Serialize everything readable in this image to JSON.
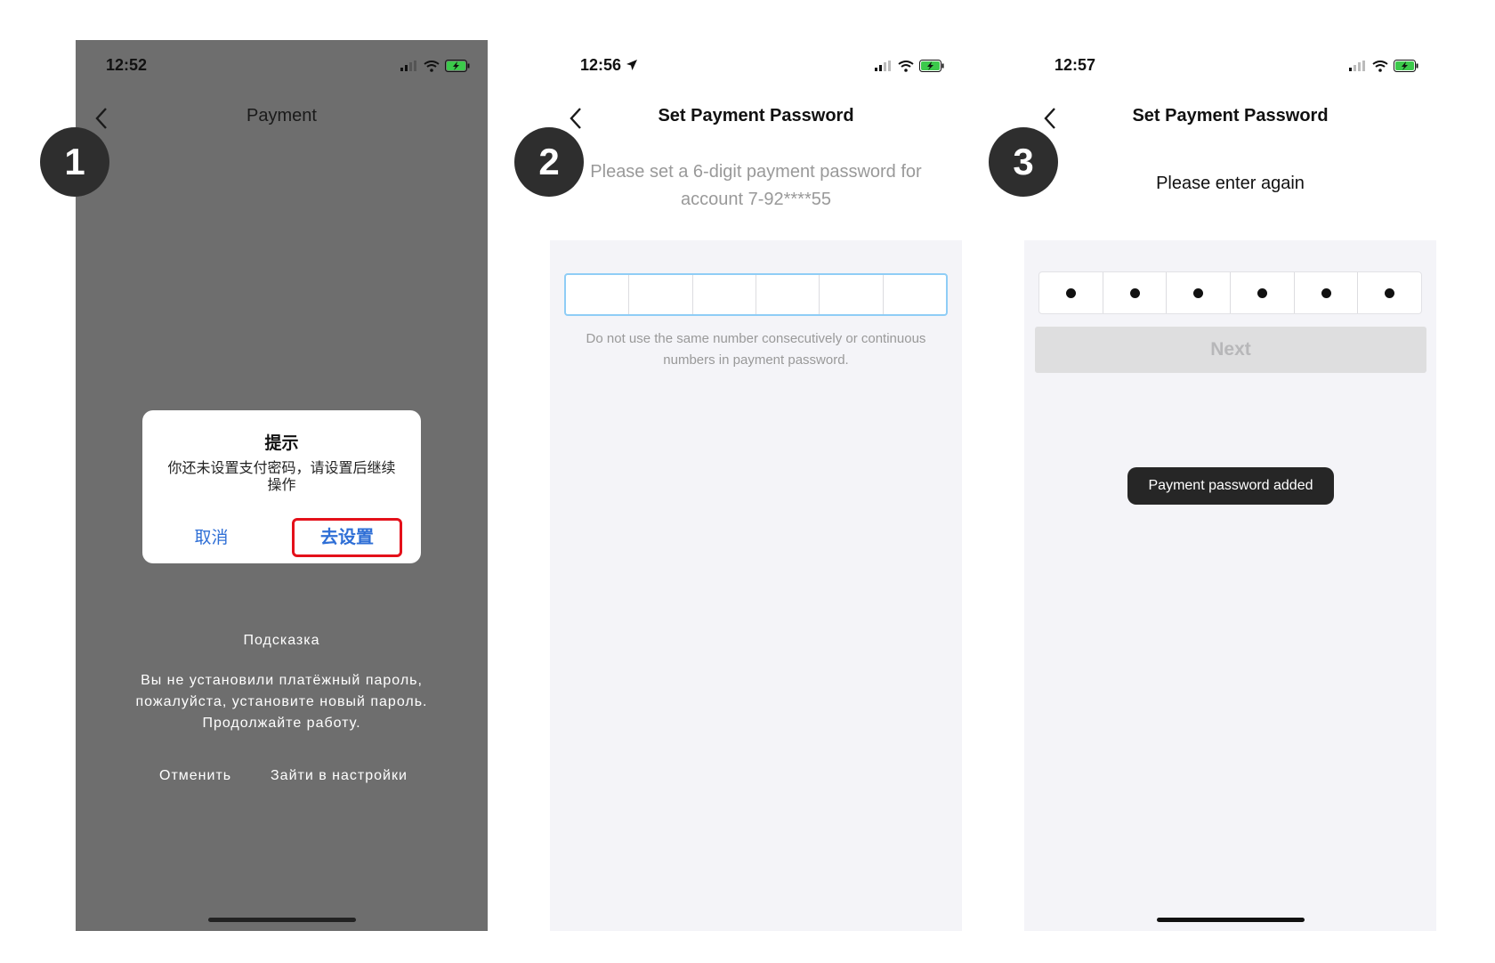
{
  "screens": [
    {
      "step": "1",
      "time": "12:52",
      "title": "Payment",
      "dialog": {
        "title": "提示",
        "message": "你还未设置支付密码，请设置后继续操作",
        "cancel": "取消",
        "confirm": "去设置"
      },
      "translation": {
        "title": "Подсказка",
        "message": "Вы не установили платёжный пароль, пожалуйста, установите новый пароль. Продолжайте работу.",
        "cancel": "Отменить",
        "settings": "Зайти в настройки"
      }
    },
    {
      "step": "2",
      "time": "12:56",
      "title": "Set Payment Password",
      "instruction": "Please set a 6-digit payment password for account 7-92****55",
      "hint": "Do not use the same number consecutively or continuous numbers in payment password.",
      "digits_filled": 0
    },
    {
      "step": "3",
      "time": "12:57",
      "title": "Set Payment Password",
      "instruction": "Please enter again",
      "digits_filled": 6,
      "next_label": "Next",
      "toast": "Payment password added"
    }
  ],
  "colors": {
    "dim_overlay": "#6e6e6e",
    "link_blue": "#2f6fd6",
    "highlight_red": "#e4101a",
    "battery_green": "#3cc94b"
  }
}
